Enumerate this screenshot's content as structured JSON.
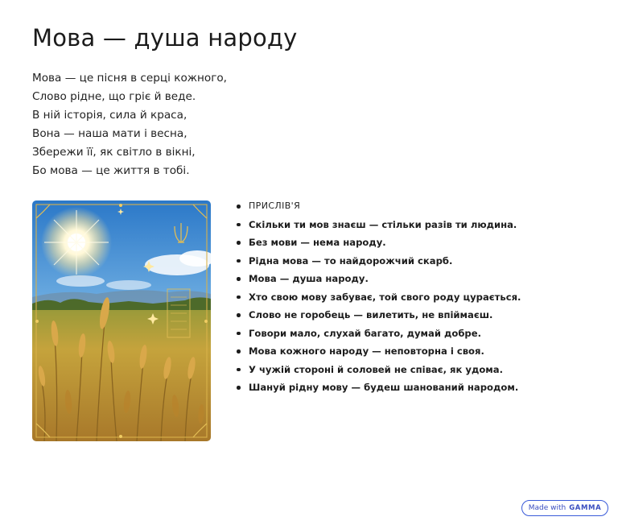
{
  "slide": {
    "title": "Мова — душа народу",
    "poem_lines": [
      "Мова — це пісня в серці кожного,",
      "Слово рідне, що гріє й веде.",
      "В ній історія, сила й краса,",
      "Вона — наша мати і весна,",
      "Збережи її, як світло в вікні,",
      "Бо мова — це життя в тобі."
    ],
    "proverbs_heading": "ПРИСЛІВ'Я",
    "proverbs": [
      "Скільки ти мов знаєш — стільки разів ти людина.",
      "Без мови — нема народу.",
      "Рідна мова — то найдорожчий скарб.",
      "Мова — душа народу.",
      "Хто свою мову забуває, той свого роду цурається.",
      "Слово не горобець — вилетить, не впіймаєш.",
      "Говори мало, слухай багато, думай добре.",
      "Мова кожного народу — неповторна і своя.",
      "У чужій стороні й соловей не співає, як удома.",
      "Шануй рідну мову — будеш шанований народом."
    ],
    "image": {
      "subject": "wheat-field-sun-ornament"
    }
  },
  "badge": {
    "prefix": "Made with",
    "brand": "GAMMA"
  },
  "colors": {
    "sky_top": "#2f7fd0",
    "sky_bottom": "#9fd0f0",
    "field": "#c9a13a",
    "ornament": "#d9b24a",
    "badge_accent": "#3a5bd9"
  }
}
